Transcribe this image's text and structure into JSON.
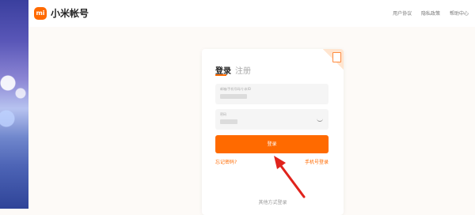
{
  "header": {
    "logo_text": "mi",
    "title": "小米帐号",
    "links": [
      "用户协议",
      "隐私政策",
      "帮助中心"
    ]
  },
  "login_card": {
    "tab_login": "登录",
    "tab_register": "注册",
    "account_field_label": "邮箱/手机号码/小米ID",
    "password_field_label": "密码",
    "login_button": "登录",
    "forgot_password": "忘记密码?",
    "phone_login": "手机号登录",
    "other_methods": "其他方式登录"
  },
  "colors": {
    "accent": "#ff6a00",
    "arrow": "#e0231c"
  }
}
